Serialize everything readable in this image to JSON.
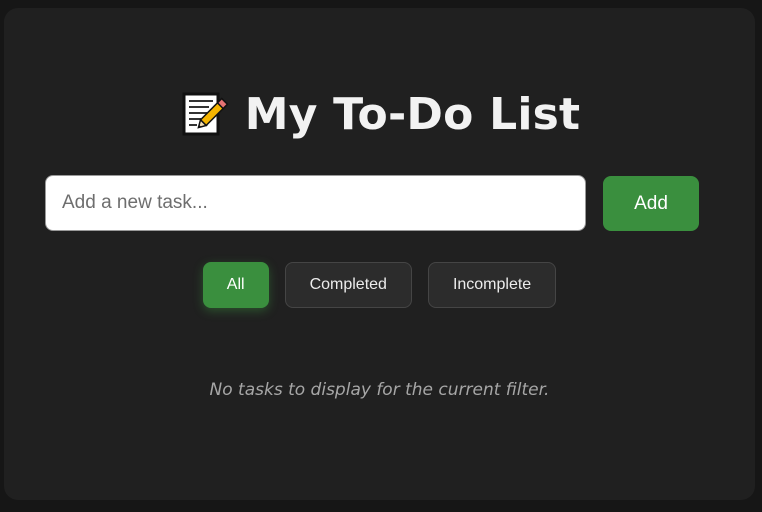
{
  "header": {
    "icon": "memo-icon",
    "title": "My To-Do List"
  },
  "new_task": {
    "placeholder": "Add a new task...",
    "value": "",
    "add_label": "Add"
  },
  "filters": {
    "items": [
      {
        "label": "All",
        "active": true
      },
      {
        "label": "Completed",
        "active": false
      },
      {
        "label": "Incomplete",
        "active": false
      }
    ]
  },
  "tasks": {
    "items": [],
    "empty_message": "No tasks to display for the current filter."
  },
  "colors": {
    "page_background": "#161616",
    "card_background": "#202020",
    "accent_green": "#3a8f3e",
    "text_primary": "#f2f2f2",
    "text_muted": "#a6a6a6"
  }
}
